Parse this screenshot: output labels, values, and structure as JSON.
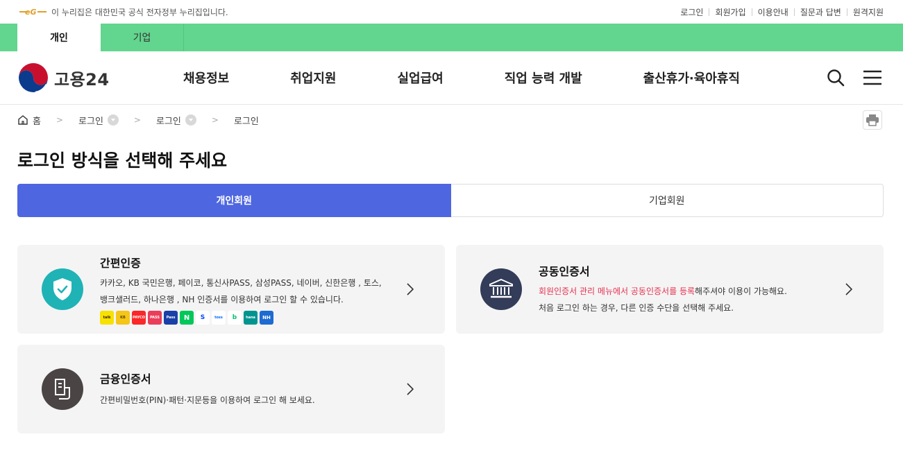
{
  "gov_banner": {
    "text": "이 누리집은 대한민국 공식 전자정부 누리집입니다."
  },
  "util_links": [
    "로그인",
    "회원가입",
    "이용안내",
    "질문과 답변",
    "원격지원"
  ],
  "user_tabs": [
    {
      "label": "개인",
      "active": true
    },
    {
      "label": "기업",
      "active": false
    }
  ],
  "brand": {
    "name": "고용24"
  },
  "gnb": [
    "채용정보",
    "취업지원",
    "실업급여",
    "직업 능력 개발",
    "출산휴가·육아휴직"
  ],
  "breadcrumb": [
    {
      "label": "홈",
      "has_dropdown": false
    },
    {
      "label": "로그인",
      "has_dropdown": true
    },
    {
      "label": "로그인",
      "has_dropdown": true
    },
    {
      "label": "로그인",
      "has_dropdown": false
    }
  ],
  "page_title": "로그인 방식을 선택해 주세요",
  "member_tabs": [
    {
      "label": "개인회원",
      "active": true
    },
    {
      "label": "기업회원",
      "active": false
    }
  ],
  "cards": {
    "simple_auth": {
      "title": "간편인증",
      "desc_line1": "카카오, KB 국민은행, 페이코, 통신사PASS, 삼성PASS, 네이버, 신한은행 , 토스,",
      "desc_line2": "뱅크샐러드, 하나은행 , NH 인증서를 이용하여 로그인 할 수 있습니다.",
      "icon": "shield-check-icon",
      "icon_color": "#1fb3b6",
      "providers": [
        {
          "name": "kakao",
          "label": "talk",
          "color": "#f7e100",
          "text_color": "#3a1d1d"
        },
        {
          "name": "kb",
          "label": "KB",
          "color": "#f5c518",
          "text_color": "#5a4a00"
        },
        {
          "name": "payco",
          "label": "PAYCO",
          "color": "#fa2828",
          "text_color": "#ffffff"
        },
        {
          "name": "pass",
          "label": "PASS",
          "color": "#ea3d5a",
          "text_color": "#ffffff"
        },
        {
          "name": "samsung-pass",
          "label": "Pass",
          "color": "#1a3fa8",
          "text_color": "#ffffff"
        },
        {
          "name": "naver",
          "label": "N",
          "color": "#03c75a",
          "text_color": "#ffffff"
        },
        {
          "name": "shinhan",
          "label": "S",
          "color": "#ffffff",
          "text_color": "#0046ff"
        },
        {
          "name": "toss",
          "label": "toss",
          "color": "#ffffff",
          "text_color": "#0064ff"
        },
        {
          "name": "banksalad",
          "label": "b",
          "color": "#ffffff",
          "text_color": "#05c072"
        },
        {
          "name": "hana",
          "label": "hana",
          "color": "#009490",
          "text_color": "#ffffff"
        },
        {
          "name": "nh",
          "label": "NH",
          "color": "#1d6ad1",
          "text_color": "#ffffff"
        }
      ]
    },
    "joint_cert": {
      "title": "공동인증서",
      "desc_highlight": "회원인증서 관리 메뉴에서 공동인증서를 등록",
      "desc_rest": "해주셔야 이용이 가능해요.",
      "desc_line2": "처음 로그인 하는 경우, 다른 인증 수단을 선택해 주세요.",
      "icon": "bank-building-icon",
      "icon_color": "#333c58"
    },
    "financial_cert": {
      "title": "금융인증서",
      "desc": "간편비밀번호(PIN)·패턴·지문등을 이용하여 로그인 해 보세요.",
      "icon": "document-icon",
      "icon_color": "#4a4544"
    }
  },
  "colors": {
    "green_bar": "#62d58e",
    "primary": "#4e66e0",
    "highlight": "#e5304f"
  }
}
